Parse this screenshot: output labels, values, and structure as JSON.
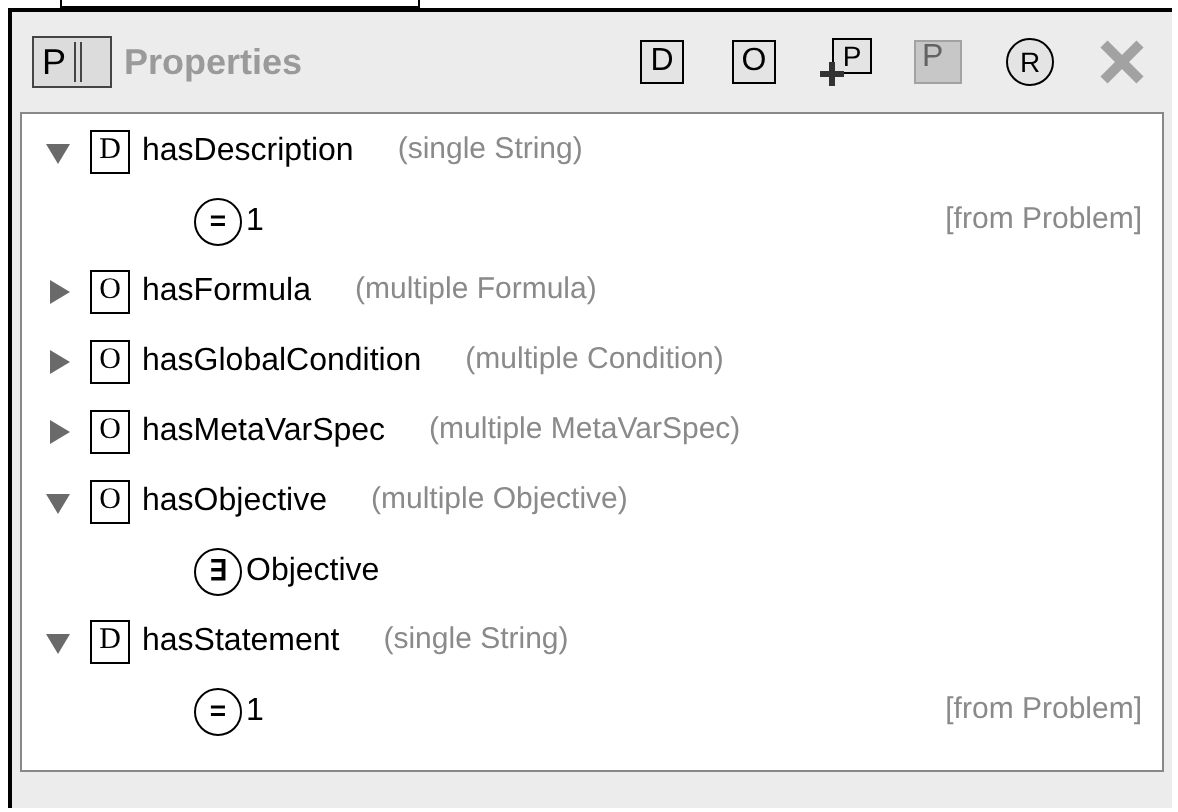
{
  "header": {
    "icon_letter": "P",
    "title": "Properties"
  },
  "toolbar": [
    {
      "letter": "D",
      "kind": "add",
      "disabled": false
    },
    {
      "letter": "O",
      "kind": "add",
      "disabled": false
    },
    {
      "letter": "P",
      "kind": "plus",
      "disabled": false
    },
    {
      "letter": "P",
      "kind": "minus",
      "disabled": true
    },
    {
      "letter": "R",
      "kind": "circle",
      "disabled": false
    },
    {
      "kind": "delete",
      "disabled": true
    }
  ],
  "properties": [
    {
      "letter": "D",
      "name": "hasDescription",
      "range": "(single String)",
      "expanded": true,
      "children": [
        {
          "symbol": "=",
          "value": "1",
          "source": "[from Problem]"
        }
      ]
    },
    {
      "letter": "O",
      "name": "hasFormula",
      "range": "(multiple Formula)",
      "expanded": false
    },
    {
      "letter": "O",
      "name": "hasGlobalCondition",
      "range": "(multiple Condition)",
      "expanded": false
    },
    {
      "letter": "O",
      "name": "hasMetaVarSpec",
      "range": "(multiple MetaVarSpec)",
      "expanded": false
    },
    {
      "letter": "O",
      "name": "hasObjective",
      "range": "(multiple Objective)",
      "expanded": true,
      "children": [
        {
          "symbol": "∃",
          "value": "Objective"
        }
      ]
    },
    {
      "letter": "D",
      "name": "hasStatement",
      "range": "(single String)",
      "expanded": true,
      "children": [
        {
          "symbol": "=",
          "value": "1",
          "source": "[from Problem]"
        }
      ]
    }
  ]
}
